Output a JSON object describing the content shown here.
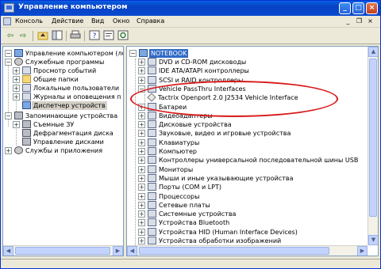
{
  "window": {
    "title": "Управление компьютером"
  },
  "menu": {
    "items": [
      "Консоль",
      "Действие",
      "Вид",
      "Окно",
      "Справка"
    ]
  },
  "toolbar": {
    "buttons": [
      "back-icon",
      "forward-icon",
      "up-icon",
      "show-tree-icon",
      "print-icon",
      "help-icon",
      "properties-icon",
      "refresh-icon"
    ]
  },
  "left_tree": {
    "root": "Управление компьютером (локаль",
    "system_tools": "Служебные программы",
    "event_viewer": "Просмотр событий",
    "shared_folders": "Общие папки",
    "local_users": "Локальные пользователи",
    "perf_logs": "Журналы и оповещения п",
    "device_manager": "Диспетчер устройств",
    "storage": "Запоминающие устройства",
    "removable": "Съемные ЗУ",
    "defrag": "Дефрагментация диска",
    "disk_mgmt": "Управление дисками",
    "services": "Службы и приложения"
  },
  "right_tree": {
    "root": "NOTEBOOK",
    "items": [
      "DVD и CD-ROM дисководы",
      "IDE ATA/ATAPI контроллеры",
      "SCSI и RAID контроллеры",
      "Vehicle PassThru Interfaces",
      "Tactrix Openport 2.0 J2534 Vehicle Interface",
      "Батареи",
      "Видеоадаптеры",
      "Дисковые устройства",
      "Звуковые, видео и игровые устройства",
      "Клавиатуры",
      "Компьютер",
      "Контроллеры универсальной последовательной шины USB",
      "Мониторы",
      "Мыши и иные указывающие устройства",
      "Порты (COM и LPT)",
      "Процессоры",
      "Сетевые платы",
      "Системные устройства",
      "Устройства Bluetooth",
      "Устройства HID (Human Interface Devices)",
      "Устройства обработки изображений"
    ]
  },
  "colors": {
    "title_bar": "#0a5fe0",
    "selection": "#316ac5",
    "highlight_ellipse": "#d91a1a"
  }
}
